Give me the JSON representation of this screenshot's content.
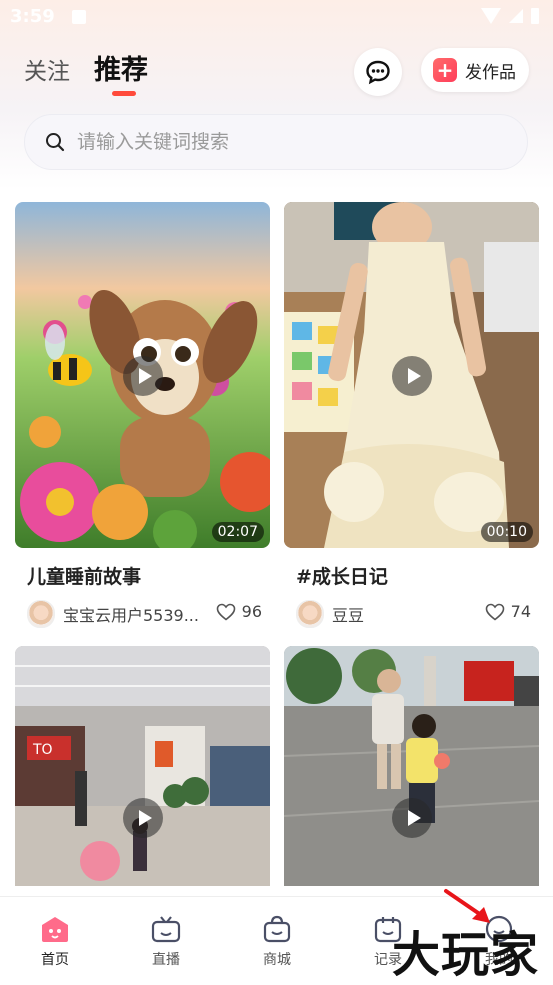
{
  "status_bar": {
    "time": "3:59"
  },
  "top_nav": {
    "tabs": [
      {
        "label": "关注",
        "active": false
      },
      {
        "label": "推荐",
        "active": true
      }
    ],
    "message_icon": "chat-bubble-icon",
    "publish_button": {
      "label": "发作品",
      "icon": "plus-square-icon"
    }
  },
  "search": {
    "placeholder": "请输入关键词搜索",
    "icon": "search-icon"
  },
  "feed": [
    {
      "title": "儿童睡前故事",
      "duration": "02:07",
      "author": "宝宝云用户5539...",
      "likes": "96"
    },
    {
      "title": "#成长日记",
      "duration": "00:10",
      "author": "豆豆",
      "likes": "74"
    },
    {
      "title": "",
      "duration": "",
      "author": "",
      "likes": ""
    },
    {
      "title": "",
      "duration": "",
      "author": "",
      "likes": ""
    }
  ],
  "bottom_nav": [
    {
      "label": "首页",
      "icon": "home-icon",
      "active": true
    },
    {
      "label": "直播",
      "icon": "tv-icon",
      "active": false
    },
    {
      "label": "商城",
      "icon": "bag-icon",
      "active": false
    },
    {
      "label": "记录",
      "icon": "calendar-icon",
      "active": false
    },
    {
      "label": "我的",
      "icon": "profile-icon",
      "active": false
    }
  ],
  "watermark": "大玩家",
  "colors": {
    "accent": "#ff4a3b",
    "brand_pink": "#ff5a7a"
  }
}
